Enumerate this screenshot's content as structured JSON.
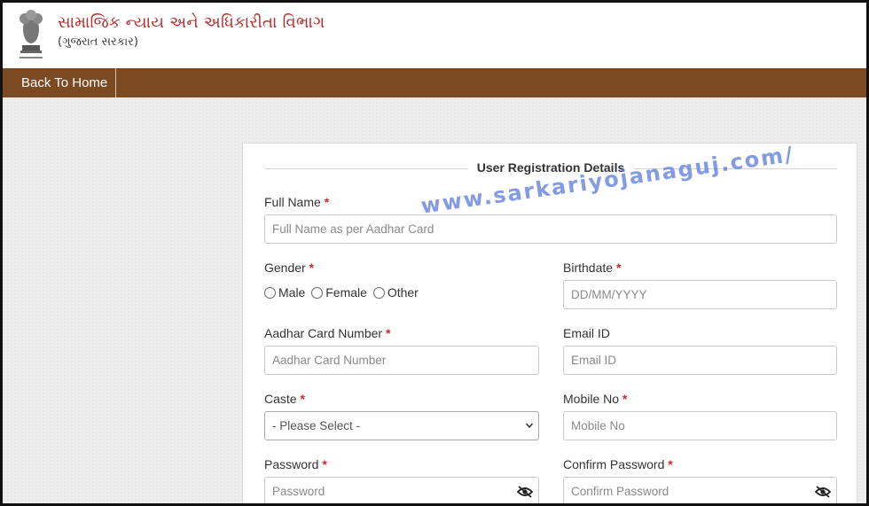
{
  "header": {
    "title": "સામાજિક ન્યાય અને અધિકારીતા વિભાગ",
    "subtitle": "(ગુજરાત સરકાર)"
  },
  "nav": {
    "back_home": "Back To Home"
  },
  "form": {
    "legend": "User Registration Details",
    "required_mark": "*",
    "full_name": {
      "label": "Full Name",
      "placeholder": "Full Name as per Aadhar Card"
    },
    "gender": {
      "label": "Gender",
      "options": [
        "Male",
        "Female",
        "Other"
      ]
    },
    "birthdate": {
      "label": "Birthdate",
      "placeholder": "DD/MM/YYYY"
    },
    "aadhar": {
      "label": "Aadhar Card Number",
      "placeholder": "Aadhar Card Number"
    },
    "email": {
      "label": "Email ID",
      "placeholder": "Email ID"
    },
    "caste": {
      "label": "Caste",
      "selected": "- Please Select -"
    },
    "mobile": {
      "label": "Mobile No",
      "placeholder": "Mobile No"
    },
    "password": {
      "label": "Password",
      "placeholder": "Password"
    },
    "confirm_password": {
      "label": "Confirm Password",
      "placeholder": "Confirm Password"
    }
  },
  "watermark": "www.sarkariyojanaguj.com/",
  "colors": {
    "nav_bg": "#7b4a22",
    "title_red": "#b5302f",
    "required_red": "#d9262b",
    "watermark_blue": "#5a78dc"
  },
  "icons": {
    "emblem": "ashoka-emblem-icon",
    "eye": "eye-slash-icon",
    "chevron": "chevron-down-icon"
  }
}
